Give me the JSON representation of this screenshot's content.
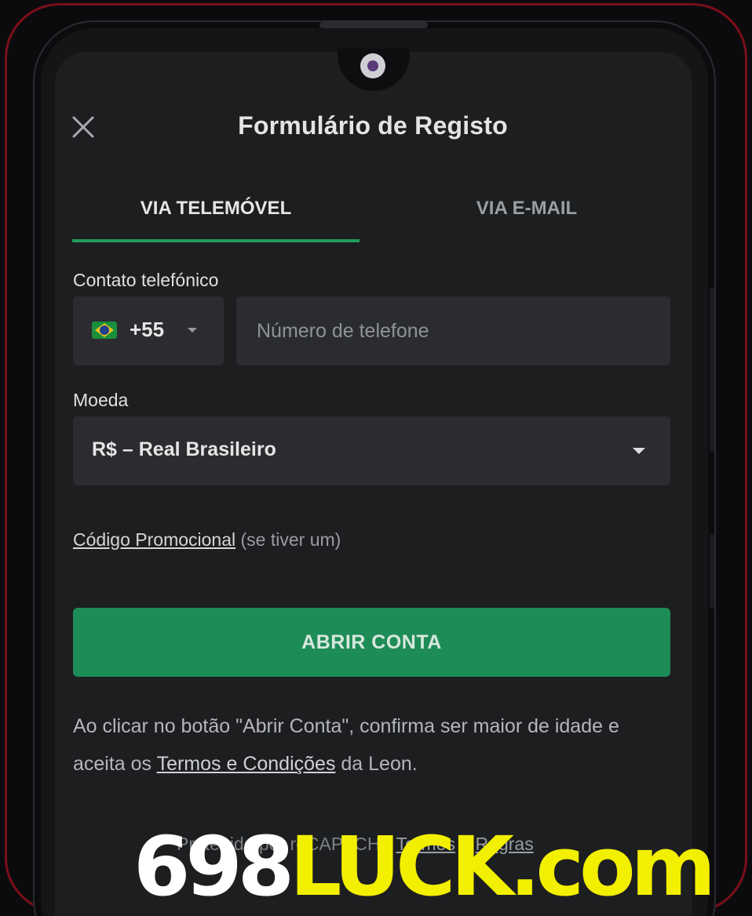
{
  "header": {
    "title": "Formulário de Registo"
  },
  "tabs": [
    {
      "label": "VIA TELEMÓVEL",
      "active": true
    },
    {
      "label": "VIA E-MAIL",
      "active": false
    }
  ],
  "phone": {
    "label": "Contato telefónico",
    "country_code": "+55",
    "country_flag": "brazil-flag-icon",
    "placeholder": "Número de telefone",
    "value": ""
  },
  "currency": {
    "label": "Moeda",
    "selected": "R$ – Real Brasileiro"
  },
  "promo": {
    "link": "Código Promocional",
    "hint": "(se tiver um)"
  },
  "submit": {
    "label": "ABRIR CONTA"
  },
  "terms": {
    "text_before": "Ao clicar no botão \"Abrir Conta\", confirma ser maior de idade e aceita os ",
    "link": "Termos e Condições",
    "text_after": " da Leon."
  },
  "recaptcha": {
    "prefix": "Protegido por reCAPTCHA",
    "terms_link": "Termos",
    "conjunction": "e",
    "rules_link": "Regras"
  },
  "watermark": {
    "part1": "698",
    "part2": "LUCK.com"
  },
  "colors": {
    "accent": "#1f9d5a",
    "button": "#1e8c57",
    "background": "#1d1e20",
    "input": "#2b2c2f",
    "frame": "#7a0f1a",
    "watermark_yellow": "#f3ef00"
  }
}
